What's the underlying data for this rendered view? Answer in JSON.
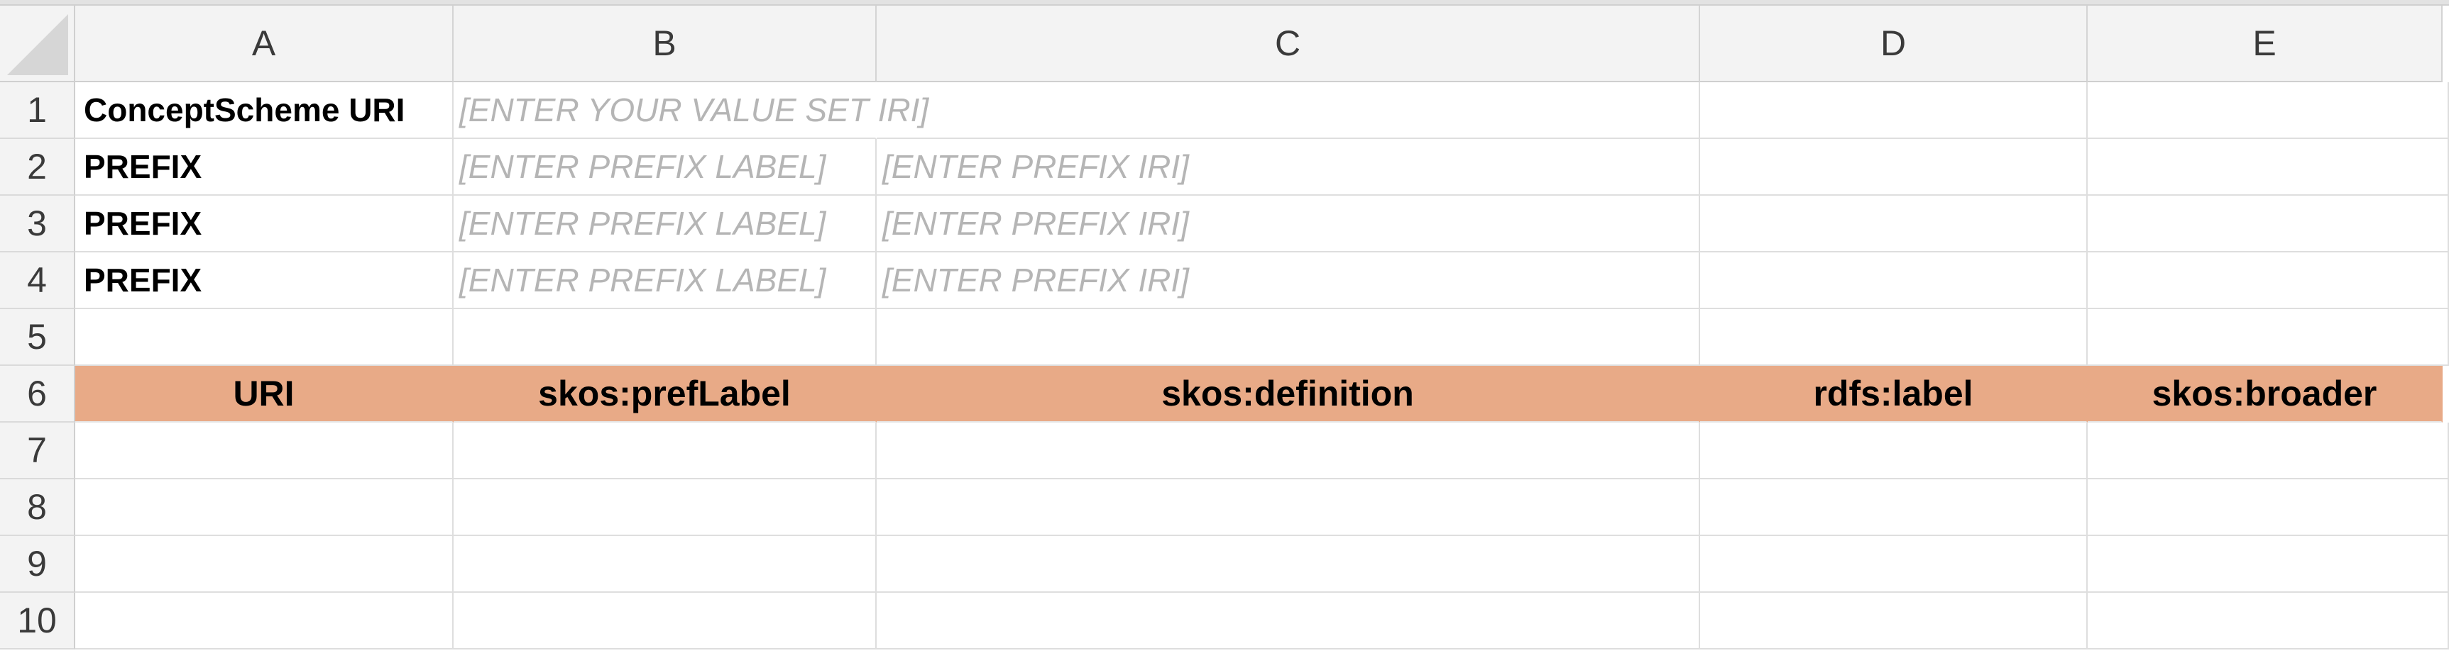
{
  "columns": [
    "A",
    "B",
    "C",
    "D",
    "E"
  ],
  "rows": [
    "1",
    "2",
    "3",
    "4",
    "5",
    "6",
    "7",
    "8",
    "9",
    "10"
  ],
  "metadata_rows": [
    {
      "label": "ConceptScheme URI",
      "value_b": "[ENTER YOUR VALUE SET IRI]",
      "value_c": ""
    },
    {
      "label": "PREFIX",
      "value_b": "[ENTER PREFIX LABEL]",
      "value_c": "[ENTER PREFIX IRI]"
    },
    {
      "label": "PREFIX",
      "value_b": "[ENTER PREFIX LABEL]",
      "value_c": "[ENTER PREFIX IRI]"
    },
    {
      "label": "PREFIX",
      "value_b": "[ENTER PREFIX LABEL]",
      "value_c": "[ENTER PREFIX IRI]"
    }
  ],
  "table_headers": [
    "URI",
    "skos:prefLabel",
    "skos:definition",
    "rdfs:label",
    "skos:broader"
  ],
  "colors": {
    "header_fill": "#e8aa87",
    "placeholder_text": "#b5b5b5"
  }
}
